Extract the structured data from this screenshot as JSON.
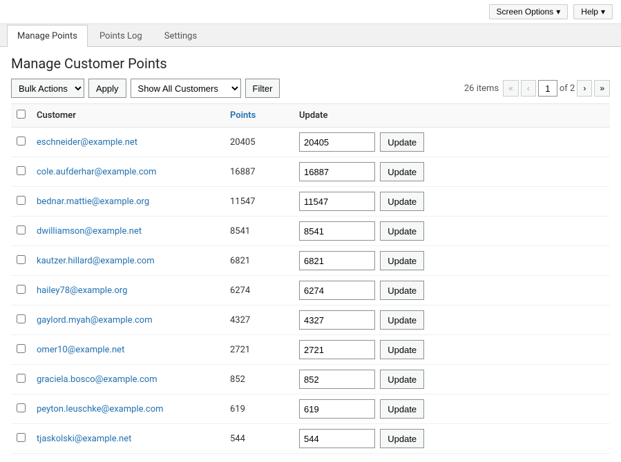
{
  "topBar": {
    "screenOptions": "Screen Options",
    "help": "Help"
  },
  "tabs": [
    {
      "label": "Manage Points",
      "active": true
    },
    {
      "label": "Points Log",
      "active": false
    },
    {
      "label": "Settings",
      "active": false
    }
  ],
  "pageTitle": "Manage Customer Points",
  "toolbar": {
    "bulkActionsLabel": "Bulk Actions",
    "applyLabel": "Apply",
    "showAllCustomers": "Show All Customers",
    "filterLabel": "Filter",
    "totalItems": "26 items",
    "currentPage": "1",
    "totalPages": "2"
  },
  "table": {
    "headers": {
      "customer": "Customer",
      "points": "Points",
      "update": "Update"
    },
    "rows": [
      {
        "email": "eschneider@example.net",
        "points": "20405",
        "updateValue": "20405"
      },
      {
        "email": "cole.aufderhar@example.com",
        "points": "16887",
        "updateValue": "16887"
      },
      {
        "email": "bednar.mattie@example.org",
        "points": "11547",
        "updateValue": "11547"
      },
      {
        "email": "dwilliamson@example.net",
        "points": "8541",
        "updateValue": "8541"
      },
      {
        "email": "kautzer.hillard@example.com",
        "points": "6821",
        "updateValue": "6821"
      },
      {
        "email": "hailey78@example.org",
        "points": "6274",
        "updateValue": "6274"
      },
      {
        "email": "gaylord.myah@example.com",
        "points": "4327",
        "updateValue": "4327"
      },
      {
        "email": "omer10@example.net",
        "points": "2721",
        "updateValue": "2721"
      },
      {
        "email": "graciela.bosco@example.com",
        "points": "852",
        "updateValue": "852"
      },
      {
        "email": "peyton.leuschke@example.com",
        "points": "619",
        "updateValue": "619"
      },
      {
        "email": "tjaskolski@example.net",
        "points": "544",
        "updateValue": "544"
      }
    ],
    "updateButtonLabel": "Update"
  }
}
